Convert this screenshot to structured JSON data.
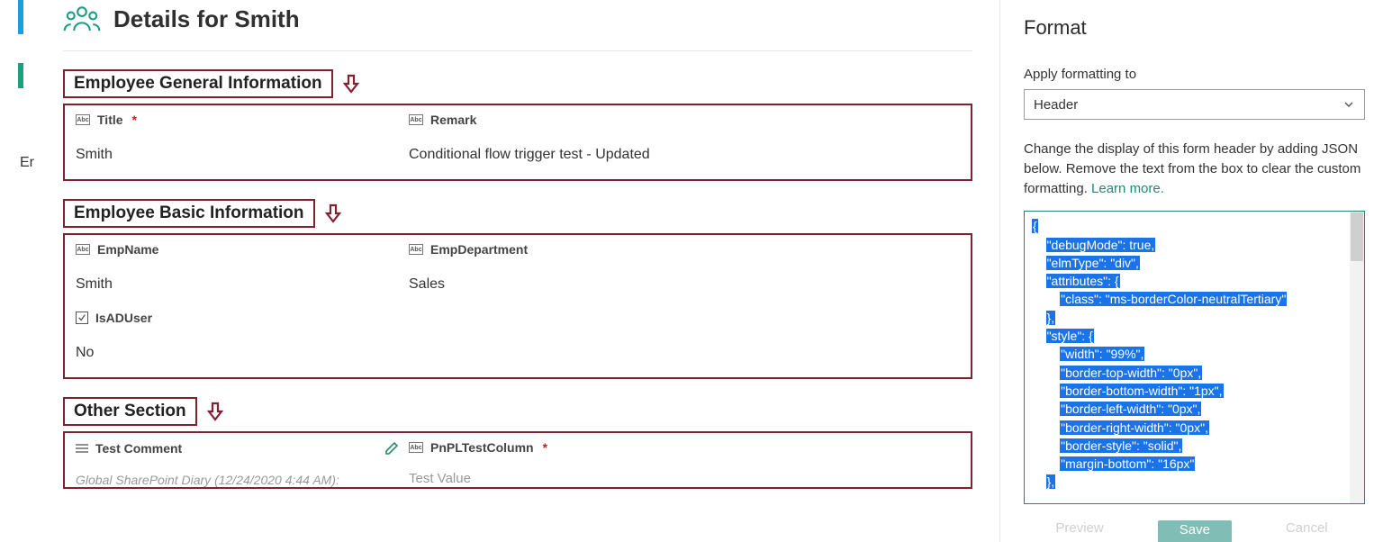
{
  "left_rail": {
    "label": "Er"
  },
  "header": {
    "title": "Details for Smith"
  },
  "sections": {
    "general": {
      "title": "Employee General Information",
      "fields": {
        "title": {
          "label": "Title",
          "required": true,
          "value": "Smith"
        },
        "remark": {
          "label": "Remark",
          "value": "Conditional flow trigger test - Updated"
        }
      }
    },
    "basic": {
      "title": "Employee Basic Information",
      "fields": {
        "empname": {
          "label": "EmpName",
          "value": "Smith"
        },
        "empdept": {
          "label": "EmpDepartment",
          "value": "Sales"
        },
        "isad": {
          "label": "IsADUser",
          "value": "No"
        }
      }
    },
    "other": {
      "title": "Other Section",
      "fields": {
        "testcomment": {
          "label": "Test Comment",
          "value": "Global SharePoint Diary (12/24/2020 4:44 AM):"
        },
        "pnpl": {
          "label": "PnPLTestColumn",
          "required": true,
          "value": "Test Value"
        }
      }
    }
  },
  "format_pane": {
    "title": "Format",
    "apply_label": "Apply formatting to",
    "dropdown_value": "Header",
    "help_text": "Change the display of this form header by adding JSON below. Remove the text from the box to clear the custom formatting. ",
    "learn_more": "Learn more.",
    "json_lines": [
      "{",
      "    \"debugMode\": true,",
      "    \"elmType\": \"div\",",
      "    \"attributes\": {",
      "        \"class\": \"ms-borderColor-neutralTertiary\"",
      "    },",
      "    \"style\": {",
      "        \"width\": \"99%\",",
      "        \"border-top-width\": \"0px\",",
      "        \"border-bottom-width\": \"1px\",",
      "        \"border-left-width\": \"0px\",",
      "        \"border-right-width\": \"0px\",",
      "        \"border-style\": \"solid\",",
      "        \"margin-bottom\": \"16px\"",
      "    },"
    ],
    "footer": {
      "preview": "Preview",
      "save": "Save",
      "cancel": "Cancel"
    }
  }
}
